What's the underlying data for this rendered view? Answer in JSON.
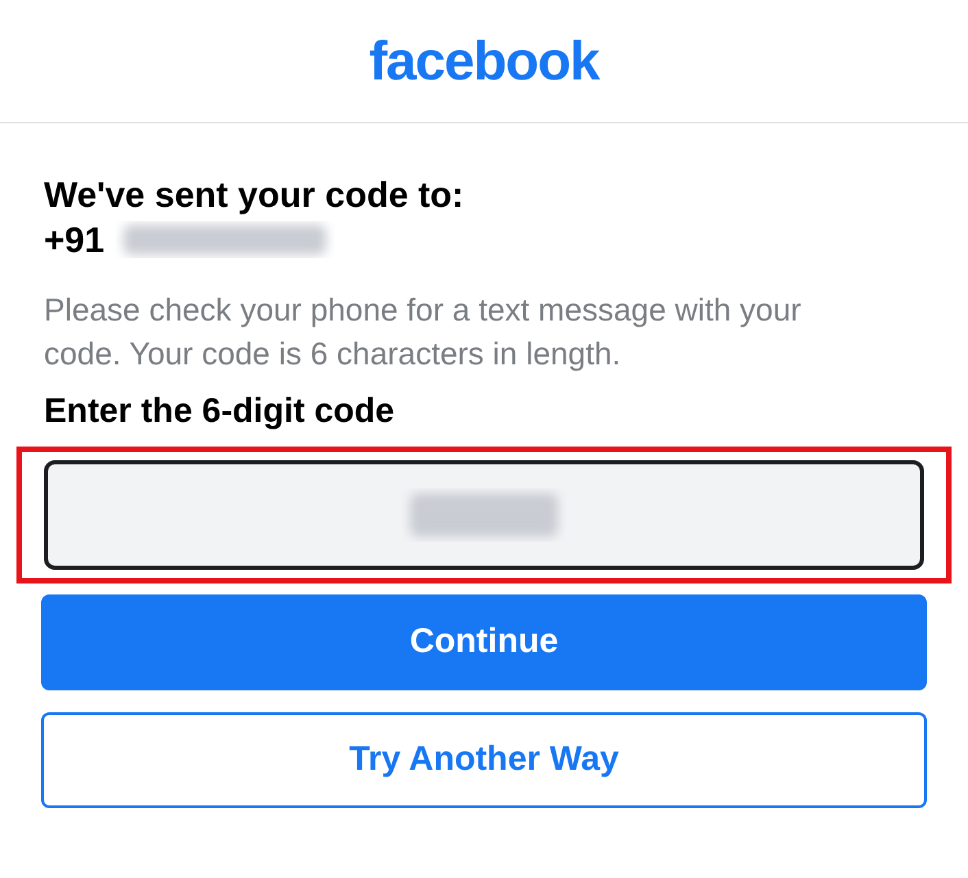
{
  "header": {
    "logo": "facebook"
  },
  "heading": "We've sent your code to:",
  "phone": {
    "prefix": "+91",
    "redacted": true
  },
  "instructions": "Please check your phone for a text message with your code. Your code is 6 characters in length.",
  "code_field": {
    "label": "Enter the 6-digit code",
    "redacted": true,
    "highlighted": true
  },
  "buttons": [
    {
      "label": "Continue",
      "kind": "primary"
    },
    {
      "label": "Try Another Way",
      "kind": "secondary"
    }
  ]
}
